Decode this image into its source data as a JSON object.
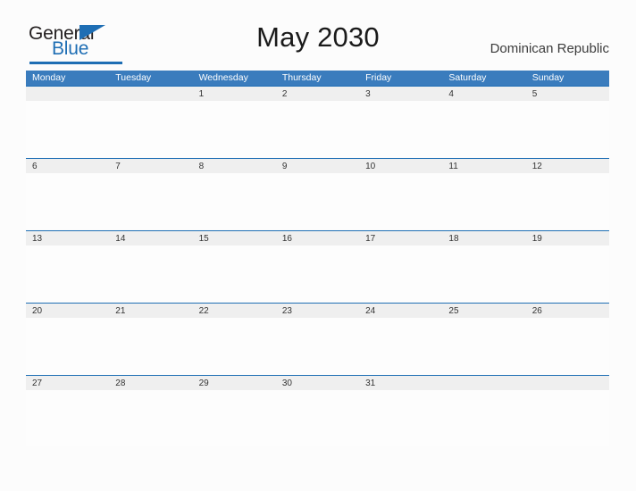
{
  "brand": {
    "name_part1": "General",
    "name_part2": "Blue",
    "flag_icon": "triangle-flag-icon",
    "colors": {
      "blue": "#1e6eb4",
      "dark": "#231f20"
    }
  },
  "header": {
    "title": "May 2030",
    "region": "Dominican Republic"
  },
  "calendar": {
    "month": "May",
    "year": "2030",
    "accent_header_color": "#3a7cbd",
    "date_band_color": "#efefef",
    "rule_color": "#1f6fb5",
    "weekdays": [
      "Monday",
      "Tuesday",
      "Wednesday",
      "Thursday",
      "Friday",
      "Saturday",
      "Sunday"
    ],
    "weeks": [
      [
        "",
        "",
        "1",
        "2",
        "3",
        "4",
        "5"
      ],
      [
        "6",
        "7",
        "8",
        "9",
        "10",
        "11",
        "12"
      ],
      [
        "13",
        "14",
        "15",
        "16",
        "17",
        "18",
        "19"
      ],
      [
        "20",
        "21",
        "22",
        "23",
        "24",
        "25",
        "26"
      ],
      [
        "27",
        "28",
        "29",
        "30",
        "31",
        "",
        ""
      ]
    ]
  }
}
